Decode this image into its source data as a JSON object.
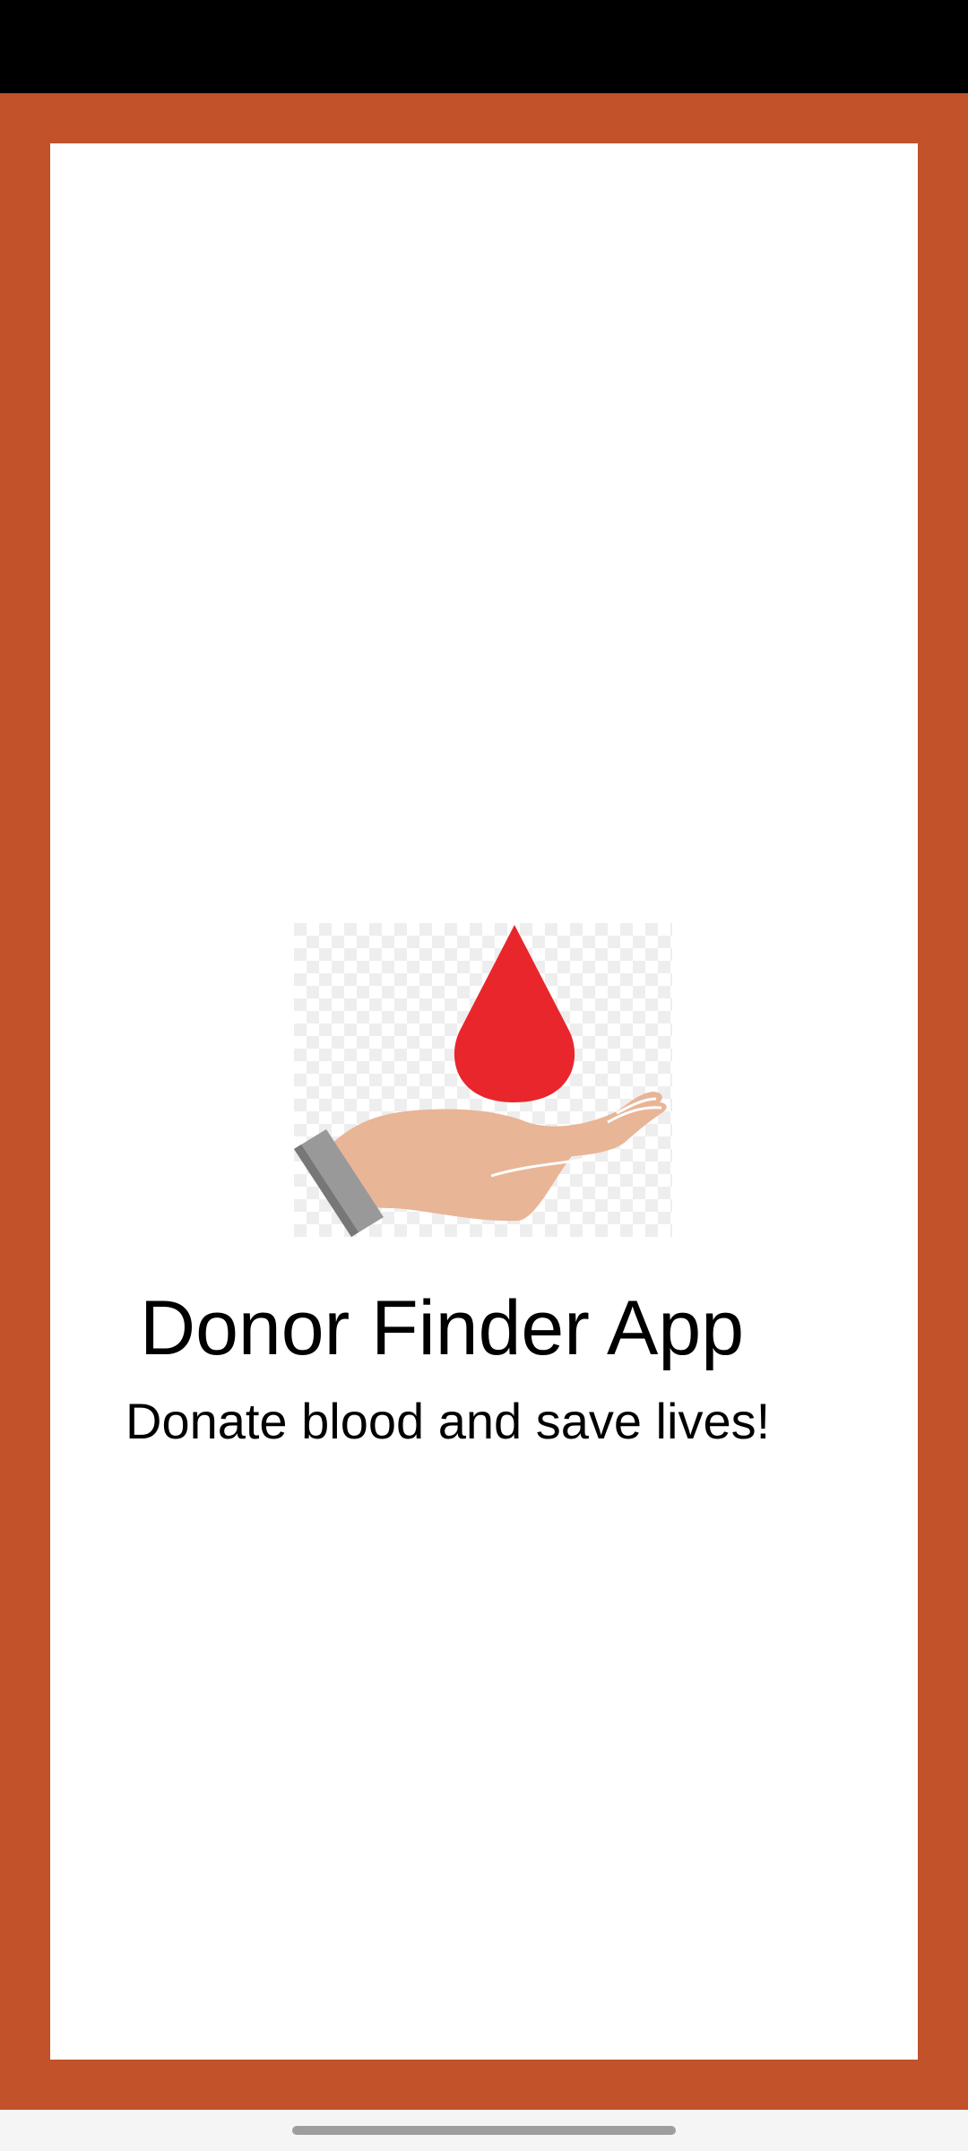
{
  "app": {
    "title": "Donor Finder App",
    "tagline": "Donate blood and save lives!"
  },
  "logo": {
    "icon": "blood-drop-hand-icon",
    "drop_color": "#e8262b",
    "hand_color": "#e8b596",
    "cuff_color": "#999999"
  },
  "colors": {
    "frame": "#c1522a",
    "card": "#ffffff",
    "status_bar": "#000000"
  }
}
